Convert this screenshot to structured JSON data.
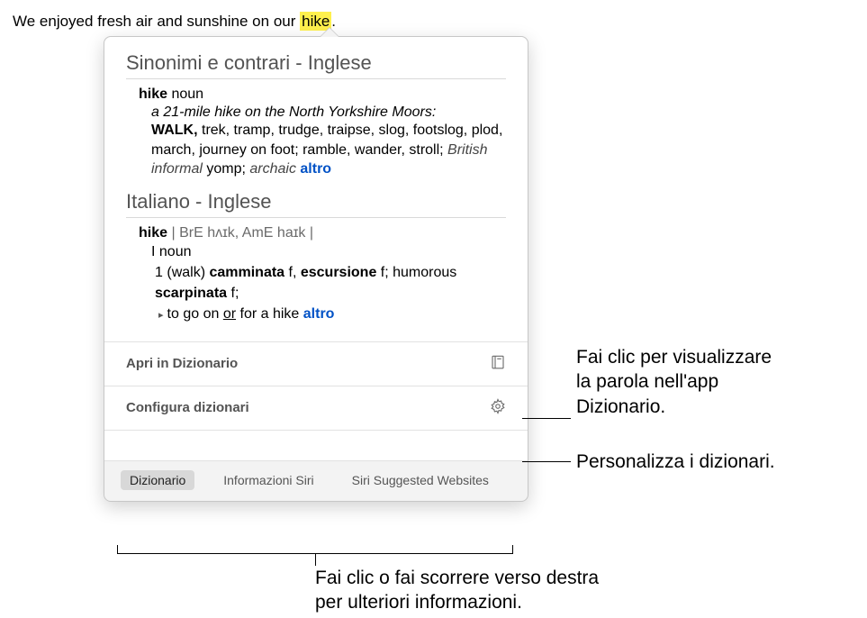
{
  "source": {
    "text_before": "We enjoyed fresh air and sunshine on our ",
    "highlighted": "hike",
    "text_after": "."
  },
  "popover": {
    "section1": {
      "title": "Sinonimi e contrari - Inglese",
      "headword": "hike",
      "pos": "noun",
      "example": "a 21-mile hike on the North Yorkshire Moors:",
      "synonyms_lead": "WALK,",
      "synonyms_rest": " trek, tramp, trudge, traipse, slog, footslog, plod, march, journey on foot; ramble, wander, stroll; ",
      "note_brit": "British informal",
      "note_brit_word": " yomp; ",
      "note_arch": "archaic",
      "more": "altro"
    },
    "section2": {
      "title": "Italiano - Inglese",
      "headword": "hike",
      "pron_sep1": " | ",
      "pron_bre_label": "BrE ",
      "pron_bre": "hʌɪk,",
      "pron_ame_label": " AmE ",
      "pron_ame": "haɪk",
      "pron_sep2": " |",
      "sense_roman": "I",
      "sense_pos": "noun",
      "def_num": "1",
      "def_gloss": "(walk)",
      "def_trans1": "camminata",
      "def_gender1": " f, ",
      "def_trans2": "escursione",
      "def_gender2": " f; ",
      "def_label": "humorous",
      "def_trans3": "scarpinata",
      "def_gender3": " f;",
      "phrase_pre": "to go on ",
      "phrase_or": "or",
      "phrase_post": " for a hike",
      "more": "altro"
    },
    "actions": {
      "open_dict": "Apri in Dizionario",
      "configure": "Configura dizionari"
    },
    "tabs": {
      "dict": "Dizionario",
      "siri_info": "Informazioni Siri",
      "siri_web": "Siri Suggested Websites"
    }
  },
  "callouts": {
    "c1_line1": "Fai clic per visualizzare",
    "c1_line2": "la parola nell'app",
    "c1_line3": "Dizionario.",
    "c2": "Personalizza i dizionari.",
    "c3_line1": "Fai clic o fai scorrere verso destra",
    "c3_line2": "per ulteriori informazioni."
  }
}
